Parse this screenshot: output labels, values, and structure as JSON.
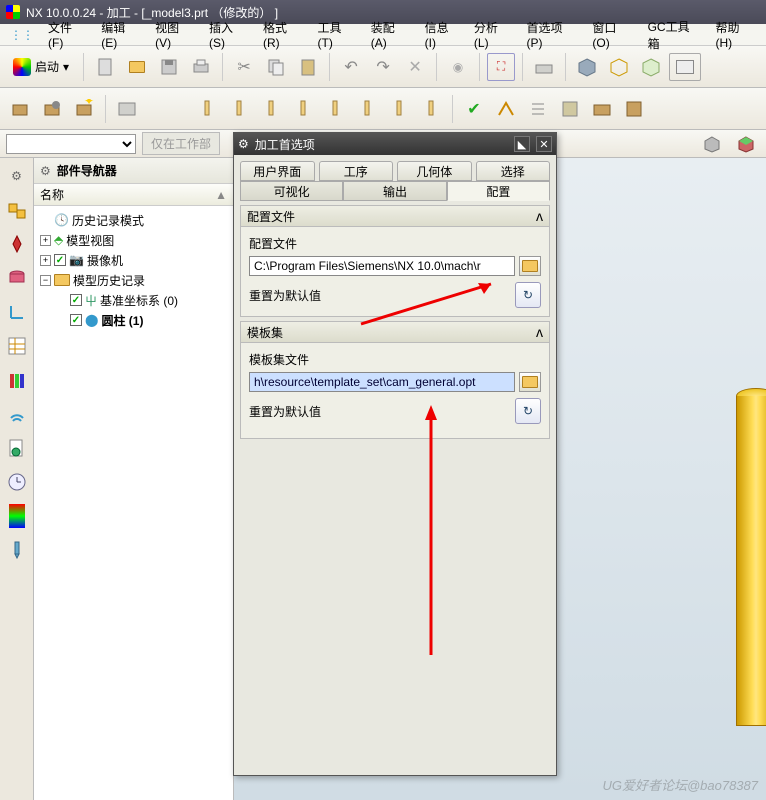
{
  "title": "NX 10.0.0.24 - 加工 - [_model3.prt  （修改的） ]",
  "menus": [
    "文件(F)",
    "编辑(E)",
    "视图(V)",
    "插入(S)",
    "格式(R)",
    "工具(T)",
    "装配(A)",
    "信息(I)",
    "分析(L)",
    "首选项(P)",
    "窗口(O)",
    "GC工具箱",
    "帮助(H)"
  ],
  "start_label": "启动",
  "sel_disabled": "仅在工作部",
  "nav": {
    "title": "部件导航器",
    "col": "名称",
    "items": {
      "history_mode": "历史记录模式",
      "model_view": "模型视图",
      "camera": "摄像机",
      "model_history": "模型历史记录",
      "datum": "基准坐标系 (0)",
      "cylinder": "圆柱 (1)"
    }
  },
  "dialog": {
    "title": "加工首选项",
    "tabs1": [
      "用户界面",
      "工序",
      "几何体",
      "选择"
    ],
    "tabs2": [
      "可视化",
      "输出",
      "配置"
    ],
    "sec1_title": "配置文件",
    "sec1_label": "配置文件",
    "sec1_path": "C:\\Program Files\\Siemens\\NX 10.0\\mach\\r",
    "reset_label": "重置为默认值",
    "sec2_title": "模板集",
    "sec2_label": "模板集文件",
    "sec2_path": "h\\resource\\template_set\\cam_general.opt"
  },
  "watermark": "UG爱好者论坛@bao78387"
}
